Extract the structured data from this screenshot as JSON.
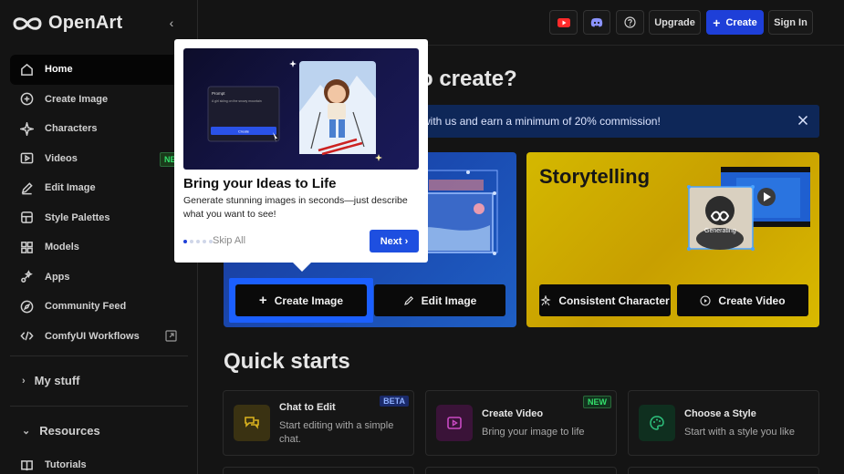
{
  "brand": {
    "name": "OpenArt"
  },
  "sidebar": {
    "items": [
      {
        "label": "Home",
        "icon": "home-icon"
      },
      {
        "label": "Create Image",
        "icon": "plus-circle-icon"
      },
      {
        "label": "Characters",
        "icon": "sparkle-icon"
      },
      {
        "label": "Videos",
        "icon": "video-icon",
        "badge": "NEW"
      },
      {
        "label": "Edit Image",
        "icon": "edit-icon"
      },
      {
        "label": "Style Palettes",
        "icon": "palette-icon"
      },
      {
        "label": "Models",
        "icon": "grid-icon"
      },
      {
        "label": "Apps",
        "icon": "apps-icon"
      },
      {
        "label": "Community Feed",
        "icon": "compass-icon"
      },
      {
        "label": "ComfyUI Workflows",
        "icon": "code-icon"
      }
    ],
    "sections": {
      "my_stuff": "My stuff",
      "resources": "Resources"
    },
    "tutorials": "Tutorials"
  },
  "topbar": {
    "upgrade": "Upgrade",
    "create": "Create",
    "sign_in": "Sign In"
  },
  "main": {
    "heading": "o create?",
    "banner": "e with us and earn a minimum of 20% commission!",
    "cards": {
      "storytelling": "Storytelling",
      "create_image": "Create Image",
      "edit_image": "Edit Image",
      "consistent_character": "Consistent Character",
      "create_video": "Create Video",
      "generating": "Generating"
    },
    "quick_starts_title": "Quick starts",
    "quick_starts": [
      {
        "title": "Chat to Edit",
        "desc": "Start editing with a simple chat.",
        "badge": "BETA",
        "color": "#c9a21a"
      },
      {
        "title": "Create Video",
        "desc": "Bring your image to life",
        "badge": "NEW",
        "color": "#b53ab0"
      },
      {
        "title": "Choose a Style",
        "desc": "Start with a style you like",
        "badge": "",
        "color": "#2ec27e"
      }
    ]
  },
  "popup": {
    "title": "Bring your Ideas to Life",
    "desc": "Generate stunning images in seconds—just describe what you want to see!",
    "skip": "Skip All",
    "next": "Next",
    "prompt_label": "Prompt",
    "prompt_text": "A girl skiing on the snowy mountain",
    "create_label": "Create"
  },
  "colors": {
    "accent": "#1e3fd8",
    "badge_green": "#33e06b"
  }
}
